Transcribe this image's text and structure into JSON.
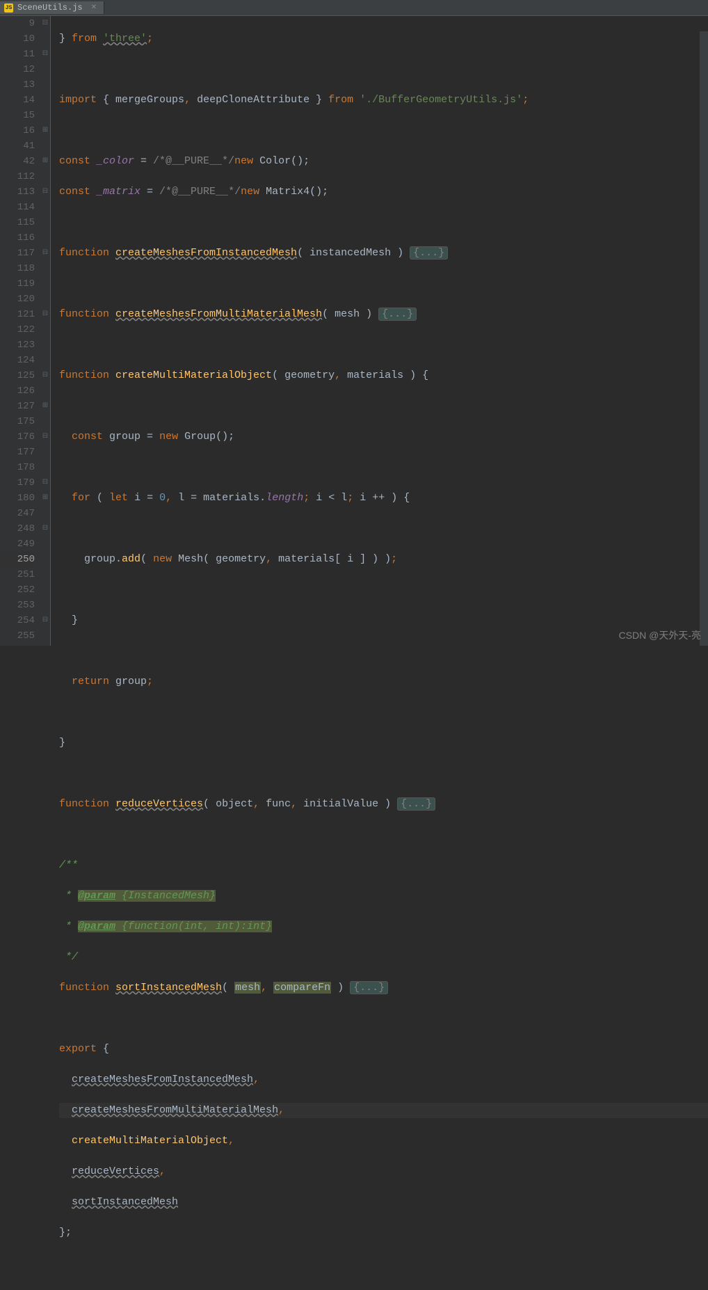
{
  "tab": {
    "filename": "SceneUtils.js",
    "icon_label": "JS"
  },
  "watermark": "CSDN @天外天-亮",
  "gutter_lines": [
    "9",
    "10",
    "11",
    "12",
    "13",
    "14",
    "15",
    "16",
    "41",
    "42",
    "112",
    "113",
    "114",
    "115",
    "116",
    "117",
    "118",
    "119",
    "120",
    "121",
    "122",
    "123",
    "124",
    "125",
    "126",
    "127",
    "175",
    "176",
    "177",
    "178",
    "179",
    "180",
    "247",
    "248",
    "249",
    "250",
    "251",
    "252",
    "253",
    "254",
    "255"
  ],
  "fold_markers": [
    "⊟",
    "",
    "⊟",
    "",
    "",
    "",
    "",
    "⊞",
    "",
    "⊞",
    "",
    "⊟",
    "",
    "",
    "",
    "⊟",
    "",
    "",
    "",
    "⊟",
    "",
    "",
    "",
    "⊟",
    "",
    "⊞",
    "",
    "⊟",
    "",
    "",
    "⊟",
    "⊞",
    "",
    "⊟",
    "",
    "",
    "",
    "",
    "",
    "⊟",
    ""
  ],
  "highlighted_line_index": 35,
  "code": {
    "l9": {
      "close": "}",
      "from": " from ",
      "mod": "'three'",
      "semi": ";"
    },
    "l11": {
      "import": "import ",
      "open": "{ ",
      "a": "mergeGroups",
      "c1": ", ",
      "b": "deepCloneAttribute",
      "close": " }",
      "from": " from ",
      "mod": "'./BufferGeometryUtils.js'",
      "semi": ";"
    },
    "l13": {
      "const": "const ",
      "name": "_color",
      "eq": " = ",
      "pure": "/*@__PURE__*/",
      "new": "new ",
      "cls": "Color",
      "rest": "();"
    },
    "l14": {
      "const": "const ",
      "name": "_matrix",
      "eq": " = ",
      "pure": "/*@__PURE__*/",
      "new": "new ",
      "cls": "Matrix4",
      "rest": "();"
    },
    "l16": {
      "fn": "function ",
      "name": "createMeshesFromInstancedMesh",
      "params": "( instancedMesh ) ",
      "fold": "{...}"
    },
    "l42": {
      "fn": "function ",
      "name": "createMeshesFromMultiMaterialMesh",
      "params": "( mesh ) ",
      "fold": "{...}"
    },
    "l113": {
      "fn": "function ",
      "name": "createMultiMaterialObject",
      "open": "( ",
      "p1": "geometry",
      "c1": ", ",
      "p2": "materials",
      "close": " ) {"
    },
    "l115": {
      "indent": "  ",
      "const": "const ",
      "name": "group",
      "eq": " = ",
      "new": "new ",
      "cls": "Group",
      "rest": "();"
    },
    "l117": {
      "indent": "  ",
      "for": "for ",
      "open": "( ",
      "let": "let ",
      "i": "i",
      "eq": " = ",
      "zero": "0",
      "c1": ", ",
      "l": "l",
      "eq2": " = ",
      "mat": "materials",
      "dot": ".",
      "len": "length",
      "semi": "; ",
      "cond": "i < l",
      "semi2": "; ",
      "inc": "i ++ ) {"
    },
    "l119": {
      "indent": "    ",
      "grp": "group",
      "dot": ".",
      "add": "add",
      "open": "( ",
      "new": "new ",
      "cls": "Mesh",
      "args": "( geometry",
      "c1": ", ",
      "mat": "materials[ i ] ) )",
      "semi": ";"
    },
    "l121": {
      "indent": "  ",
      "close": "}"
    },
    "l123": {
      "indent": "  ",
      "ret": "return ",
      "grp": "group",
      "semi": ";"
    },
    "l125": {
      "close": "}"
    },
    "l127": {
      "fn": "function ",
      "name": "reduceVertices",
      "open": "( ",
      "p1": "object",
      "c1": ", ",
      "p2": "func",
      "c2": ", ",
      "p3": "initialValue",
      "close": " ) ",
      "fold": "{...}"
    },
    "l176": {
      "open": "/**"
    },
    "l177": {
      "star": " * ",
      "tag": "@param",
      "type": " {InstancedMesh}"
    },
    "l178": {
      "star": " * ",
      "tag": "@param",
      "type": " {function(int, int):int}"
    },
    "l179": {
      "close": " */"
    },
    "l180": {
      "fn": "function ",
      "name": "sortInstancedMesh",
      "open": "( ",
      "p1": "mesh",
      "c1": ", ",
      "p2": "compareFn",
      "close": " ) ",
      "fold": "{...}"
    },
    "l248": {
      "export": "export ",
      "open": "{"
    },
    "l249": {
      "indent": "  ",
      "name": "createMeshesFromInstancedMesh",
      "c": ","
    },
    "l250": {
      "indent": "  ",
      "name": "createMeshesFromMultiMaterialMesh",
      "c": ","
    },
    "l251": {
      "indent": "  ",
      "name": "createMultiMaterialObject",
      "c": ","
    },
    "l252": {
      "indent": "  ",
      "name": "reduceVertices",
      "c": ","
    },
    "l253": {
      "indent": "  ",
      "name": "sortInstancedMesh"
    },
    "l254": {
      "close": "};"
    }
  }
}
